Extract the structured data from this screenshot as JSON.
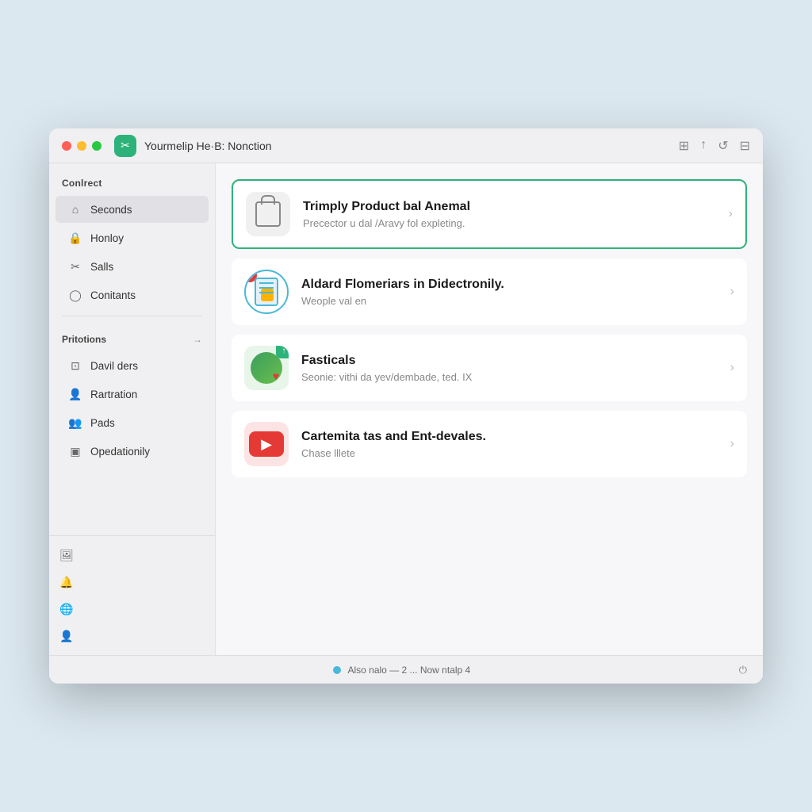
{
  "window": {
    "title": "Yourmelip He·B: Nonction"
  },
  "titlebar": {
    "traffic_lights": [
      "close",
      "minimize",
      "maximize"
    ],
    "app_icon_label": "✂",
    "title": "Yourmelip He·B: Nonction",
    "actions": [
      "edit",
      "upload",
      "refresh",
      "grid"
    ]
  },
  "sidebar": {
    "section1_label": "Conlrect",
    "items1": [
      {
        "label": "Seconds",
        "icon": "home-icon",
        "active": true
      },
      {
        "label": "Honloy",
        "icon": "lock-icon"
      },
      {
        "label": "Salls",
        "icon": "scissors-icon"
      },
      {
        "label": "Conitants",
        "icon": "person-icon"
      }
    ],
    "section2_label": "Pritotions",
    "section2_has_arrow": true,
    "items2": [
      {
        "label": "Davil ders",
        "icon": "layout-icon"
      },
      {
        "label": "Rartration",
        "icon": "person-icon"
      },
      {
        "label": "Pads",
        "icon": "group-icon"
      },
      {
        "label": "Opedationily",
        "icon": "square-icon"
      }
    ],
    "bottom_icons": [
      "image-icon",
      "bell-icon",
      "globe-icon",
      "person-circle-icon"
    ]
  },
  "list_items": [
    {
      "id": 1,
      "title": "Trimply Product bal Anemal",
      "subtitle": "Precector u dal /Aravy fol expleting.",
      "active": true,
      "icon_type": "bag",
      "badge": null
    },
    {
      "id": 2,
      "title": "Aldard Flomeriars in Didectronily.",
      "subtitle": "Weople val en",
      "active": false,
      "icon_type": "document",
      "badge": "red-x"
    },
    {
      "id": 3,
      "title": "Fasticals",
      "subtitle": "Seonie: vithi da yev/dembade, ted. IX",
      "active": false,
      "icon_type": "globe",
      "badge": "green"
    },
    {
      "id": 4,
      "title": "Cartemita tas and Ent-devales.",
      "subtitle": "Chase lllete",
      "active": false,
      "icon_type": "youtube",
      "badge": null
    }
  ],
  "status_bar": {
    "left_label": "",
    "center_text": "Also nalo — 2 ... Now ntalp 4",
    "right_label": "⏻"
  }
}
